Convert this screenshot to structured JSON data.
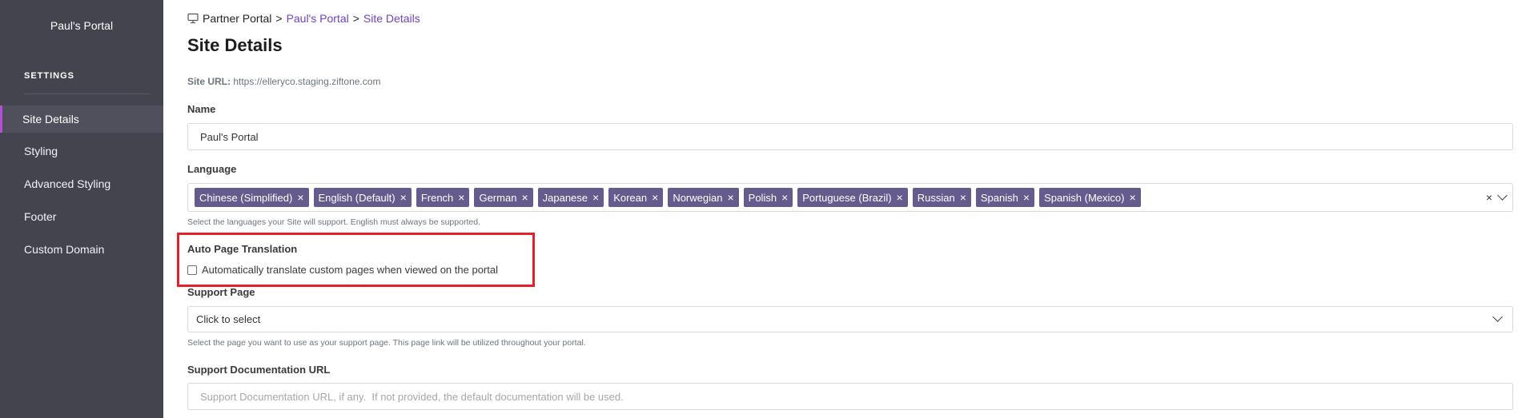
{
  "sidebar": {
    "portal_name": "Paul's Portal",
    "section_label": "SETTINGS",
    "items": [
      {
        "label": "Site Details",
        "active": true
      },
      {
        "label": "Styling",
        "active": false
      },
      {
        "label": "Advanced Styling",
        "active": false
      },
      {
        "label": "Footer",
        "active": false
      },
      {
        "label": "Custom Domain",
        "active": false
      }
    ]
  },
  "breadcrumb": {
    "root": "Partner Portal",
    "separator": ">",
    "middle": "Paul's Portal",
    "current": "Site Details"
  },
  "page": {
    "title": "Site Details",
    "site_url_label": "Site URL:",
    "site_url": "https://elleryco.staging.ziftone.com"
  },
  "name_field": {
    "label": "Name",
    "value": "Paul's Portal"
  },
  "language_field": {
    "label": "Language",
    "tags": [
      "Chinese (Simplified)",
      "English (Default)",
      "French",
      "German",
      "Japanese",
      "Korean",
      "Norwegian",
      "Polish",
      "Portuguese (Brazil)",
      "Russian",
      "Spanish",
      "Spanish (Mexico)"
    ],
    "tag_remove_glyph": "×",
    "clear_glyph": "×",
    "help": "Select the languages your Site will support. English must always be supported."
  },
  "auto_translation": {
    "label": "Auto Page Translation",
    "checkbox_label": "Automatically translate custom pages when viewed on the portal",
    "checked": false
  },
  "support_page": {
    "label": "Support Page",
    "value": "Click to select",
    "help": "Select the page you want to use as your support page. This page link will be utilized throughout your portal."
  },
  "support_doc": {
    "label": "Support Documentation URL",
    "placeholder": "Support Documentation URL, if any.  If not provided, the default documentation will be used."
  },
  "colors": {
    "sidebar_bg": "#44444f",
    "accent": "#6f42c1",
    "tag_bg": "#655b8c",
    "highlight": "#e4202b"
  }
}
